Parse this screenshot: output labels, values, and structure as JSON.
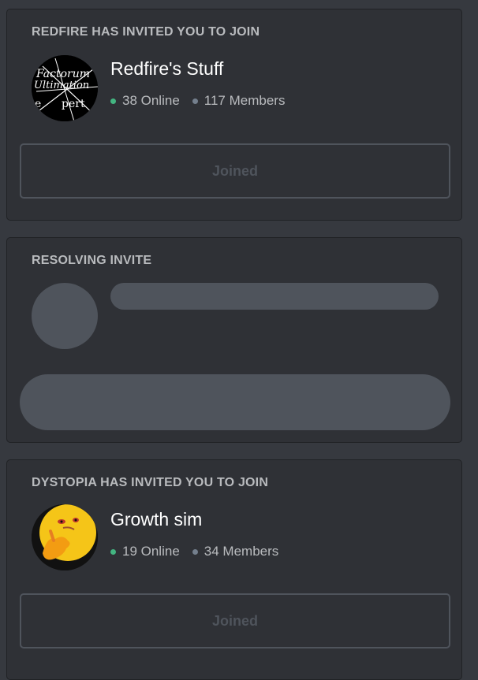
{
  "invites": [
    {
      "header": "REDFIRE HAS INVITED YOU TO JOIN",
      "server_name": "Redfire's Stuff",
      "online": "38 Online",
      "members": "117 Members",
      "button_label": "Joined",
      "avatar_text": [
        "Factorum",
        "Ultimation",
        "e",
        "pert"
      ]
    },
    {
      "header": "RESOLVING INVITE"
    },
    {
      "header": "DYSTOPIA HAS INVITED YOU TO JOIN",
      "server_name": "Growth sim",
      "online": "19 Online",
      "members": "34 Members",
      "button_label": "Joined"
    }
  ],
  "colors": {
    "online_dot": "#43b581",
    "members_dot": "#747f8d",
    "card_bg": "#2f3136",
    "page_bg": "#36393f",
    "skeleton": "#4f545c"
  }
}
